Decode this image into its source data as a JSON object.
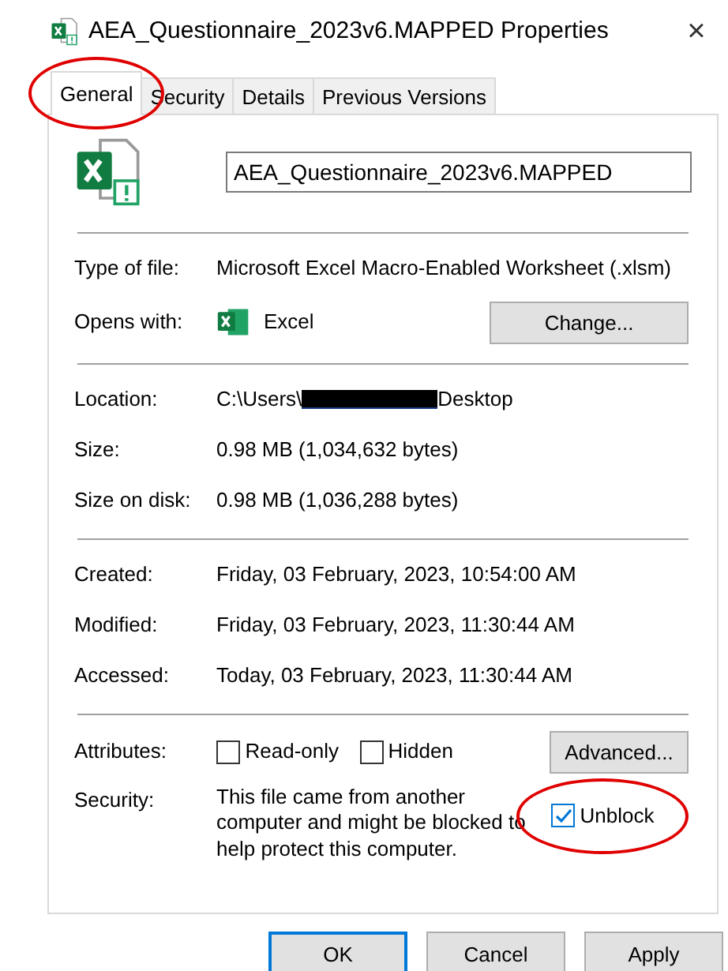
{
  "window": {
    "title": "AEA_Questionnaire_2023v6.MAPPED Properties",
    "close": "×"
  },
  "tabs": [
    {
      "label": "General",
      "selected": true,
      "circled": true
    },
    {
      "label": "Security",
      "selected": false,
      "circled": false
    },
    {
      "label": "Details",
      "selected": false,
      "circled": false
    },
    {
      "label": "Previous Versions",
      "selected": false,
      "circled": false
    }
  ],
  "file_name": "AEA_Questionnaire_2023v6.MAPPED",
  "type_rows": [
    {
      "label": "Type of file:",
      "value": "Microsoft Excel Macro-Enabled Worksheet (.xlsm)"
    }
  ],
  "opens_with": {
    "label": "Opens with:",
    "app": "Excel",
    "button": "Change..."
  },
  "location": {
    "label": "Location:",
    "prefix": "C:\\Users\\",
    "redacted": true,
    "suffix": "Desktop"
  },
  "size_rows": [
    {
      "label": "Size:",
      "value": "0.98 MB (1,034,632 bytes)"
    },
    {
      "label": "Size on disk:",
      "value": "0.98 MB (1,036,288 bytes)"
    }
  ],
  "date_rows": [
    {
      "label": "Created:",
      "value": "Friday, 03 February, 2023, 10:54:00 AM"
    },
    {
      "label": "Modified:",
      "value": "Friday, 03 February, 2023, 11:30:44 AM"
    },
    {
      "label": "Accessed:",
      "value": "Today, 03 February, 2023, 11:30:44 AM"
    }
  ],
  "attributes": {
    "label": "Attributes:",
    "checkboxes": [
      {
        "label": "Read-only",
        "checked": false
      },
      {
        "label": "Hidden",
        "checked": false
      }
    ],
    "button": "Advanced..."
  },
  "security": {
    "label": "Security:",
    "text": "This file came from another computer and might be blocked to help protect this computer.",
    "unblock": {
      "label": "Unblock",
      "checked": true,
      "circled": true
    }
  },
  "buttons": [
    {
      "label": "OK",
      "default": true
    },
    {
      "label": "Cancel",
      "default": false
    },
    {
      "label": "Apply",
      "default": false
    }
  ]
}
